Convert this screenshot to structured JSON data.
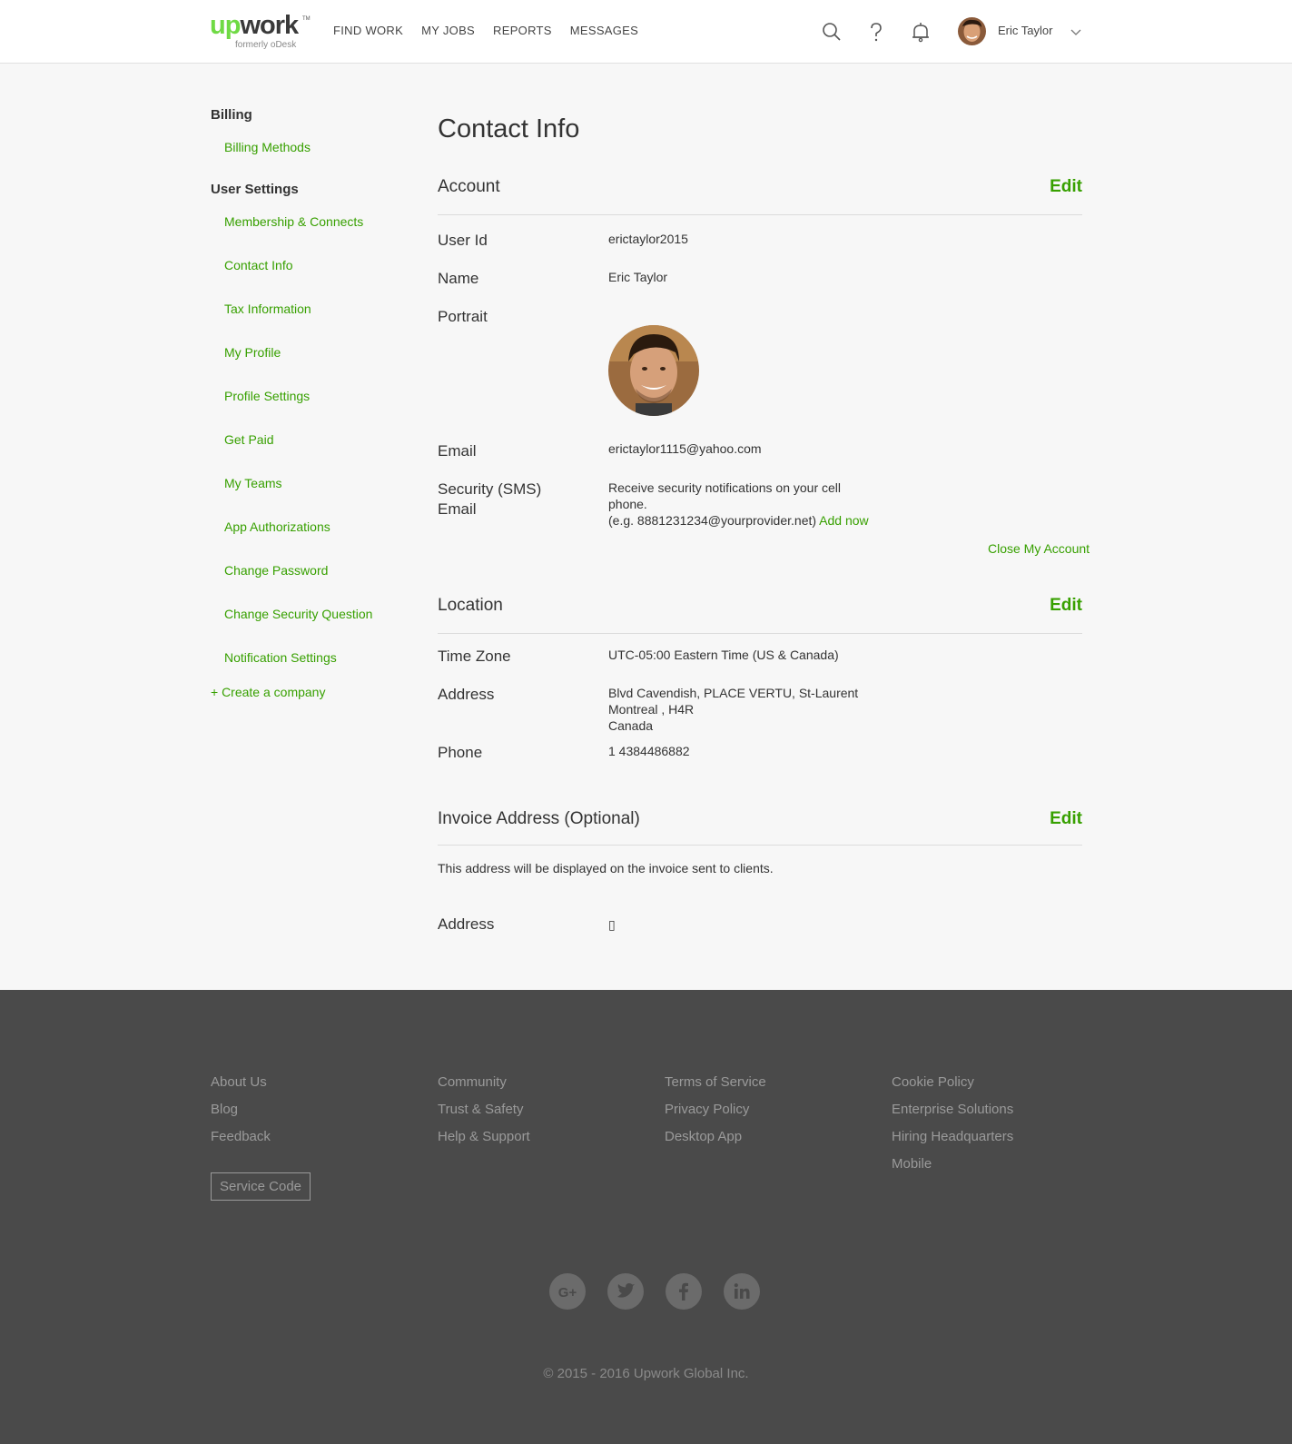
{
  "header": {
    "logo_up": "up",
    "logo_work": "work",
    "logo_tm": "TM",
    "logo_sub": "formerly oDesk",
    "nav": [
      "FIND WORK",
      "MY JOBS",
      "REPORTS",
      "MESSAGES"
    ],
    "user_name": "Eric Taylor",
    "icons": [
      "search-icon",
      "help-icon",
      "bell-icon",
      "chevron-down-icon"
    ]
  },
  "sidebar": {
    "billing_heading": "Billing",
    "billing_items": [
      "Billing Methods"
    ],
    "user_settings_heading": "User Settings",
    "user_items": [
      "Membership & Connects",
      "Contact Info",
      "Tax Information",
      "My Profile",
      "Profile Settings",
      "Get Paid",
      "My Teams",
      "App Authorizations",
      "Change Password",
      "Change Security Question",
      "Notification Settings"
    ],
    "create_company": "+ Create a company"
  },
  "main": {
    "title": "Contact Info",
    "account": {
      "title": "Account",
      "edit": "Edit",
      "user_id_label": "User Id",
      "user_id": "erictaylor2015",
      "name_label": "Name",
      "name": "Eric Taylor",
      "portrait_label": "Portrait",
      "email_label": "Email",
      "email": "erictaylor1115@yahoo.com",
      "sms_label_1": "Security (SMS)",
      "sms_label_2": "Email",
      "sms_text_1": "Receive security notifications on your cell",
      "sms_text_2": "phone.",
      "sms_text_3": "(e.g. 8881231234@yourprovider.net)",
      "add_now": "Add now",
      "close_account": "Close My Account"
    },
    "location": {
      "title": "Location",
      "edit": "Edit",
      "timezone_label": "Time Zone",
      "timezone": "UTC-05:00 Eastern Time (US & Canada)",
      "address_label": "Address",
      "address_1": "Blvd Cavendish, PLACE VERTU, St-Laurent",
      "address_2": "Montreal , H4R",
      "address_3": "Canada",
      "phone_label": "Phone",
      "phone": "1 4384486882"
    },
    "invoice": {
      "title": "Invoice Address (Optional)",
      "edit": "Edit",
      "note": "This address will be displayed on the invoice sent to clients.",
      "address_label": "Address",
      "address_value": "▯"
    }
  },
  "footer": {
    "col1": [
      "About Us",
      "Blog",
      "Feedback"
    ],
    "col2": [
      "Community",
      "Trust & Safety",
      "Help & Support"
    ],
    "col3": [
      "Terms of Service",
      "Privacy Policy",
      "Desktop App"
    ],
    "col4": [
      "Cookie Policy",
      "Enterprise Solutions",
      "Hiring Headquarters",
      "Mobile"
    ],
    "service_code": "Service Code",
    "social": [
      "google-plus-icon",
      "twitter-icon",
      "facebook-icon",
      "linkedin-icon"
    ],
    "copyright": "© 2015 - 2016 Upwork Global Inc."
  },
  "colors": {
    "brand_green": "#37a000",
    "logo_green": "#6fda44",
    "footer_bg": "#4a4a4a"
  }
}
